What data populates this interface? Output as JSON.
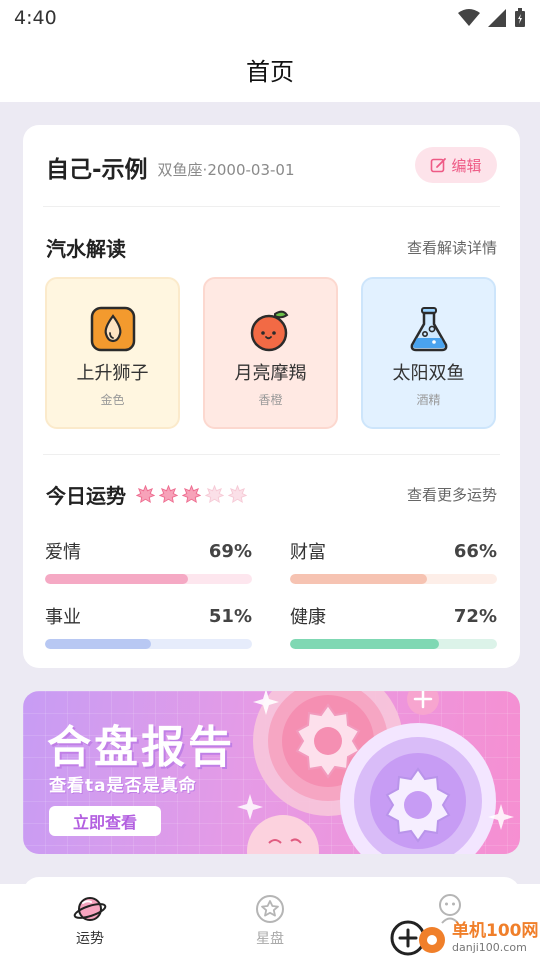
{
  "status_bar": {
    "time": "4:40"
  },
  "header": {
    "title": "首页"
  },
  "profile": {
    "name": "自己-示例",
    "meta": "双鱼座·2000-03-01",
    "edit_label": "编辑"
  },
  "reading": {
    "title": "汽水解读",
    "link": "查看解读详情",
    "tiles": [
      {
        "title": "上升狮子",
        "sub": "金色",
        "icon": "drop-icon",
        "bg": "#fff6e0",
        "border": "#fbeacb"
      },
      {
        "title": "月亮摩羯",
        "sub": "香橙",
        "icon": "orange-icon",
        "bg": "#ffe9e3",
        "border": "#fcd8cf"
      },
      {
        "title": "太阳双鱼",
        "sub": "酒精",
        "icon": "flask-icon",
        "bg": "#e2f1ff",
        "border": "#cde5fb"
      }
    ]
  },
  "fortune": {
    "title": "今日运势",
    "link": "查看更多运势",
    "stars_filled": 3,
    "stars_total": 5,
    "metrics": [
      {
        "label": "爱情",
        "value": "69%",
        "percent": 69,
        "color": "#f5a9c4",
        "track": "#fde6ee"
      },
      {
        "label": "财富",
        "value": "66%",
        "percent": 66,
        "color": "#f6c3b2",
        "track": "#fdeee8"
      },
      {
        "label": "事业",
        "value": "51%",
        "percent": 51,
        "color": "#b8c8f3",
        "track": "#e6ecfb"
      },
      {
        "label": "健康",
        "value": "72%",
        "percent": 72,
        "color": "#7fd8b3",
        "track": "#dcf3e9"
      }
    ]
  },
  "banner": {
    "title": "合盘报告",
    "subtitle": "查看ta是否是真命",
    "button": "立即查看"
  },
  "nav": {
    "items": [
      {
        "label": "运势",
        "icon": "planet-icon",
        "active": true
      },
      {
        "label": "星盘",
        "icon": "star-chart-icon",
        "active": false
      },
      {
        "label": "",
        "icon": "profile-icon",
        "active": false
      }
    ]
  },
  "watermark": {
    "main": "单机100网",
    "url": "danji100.com"
  },
  "colors": {
    "accent": "#ee5a85",
    "banner_start": "#c79cf4",
    "banner_end": "#f68fd1"
  }
}
